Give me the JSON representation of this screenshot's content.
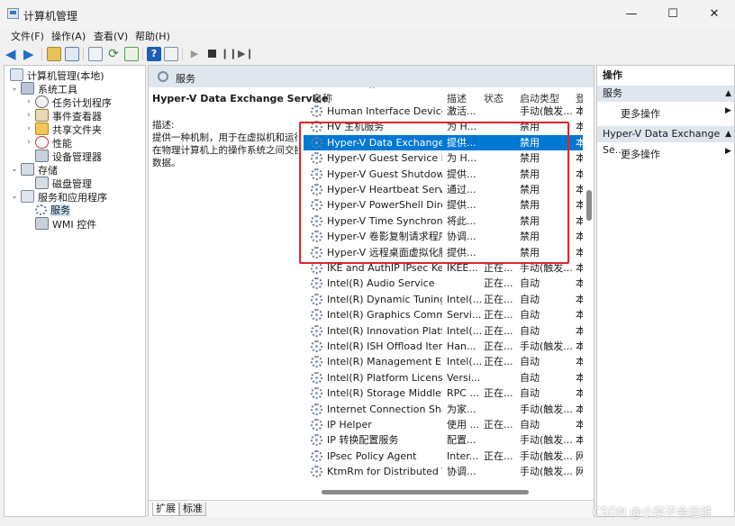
{
  "window": {
    "title": "计算机管理",
    "min": "—",
    "max": "☐",
    "close": "✕"
  },
  "menu": [
    "文件(F)",
    "操作(A)",
    "查看(V)",
    "帮助(H)"
  ],
  "tree": [
    {
      "label": "计算机管理(本地)",
      "expander": ""
    },
    {
      "label": "系统工具",
      "expander": "⌄"
    },
    {
      "label": "任务计划程序",
      "expander": "›"
    },
    {
      "label": "事件查看器",
      "expander": "›"
    },
    {
      "label": "共享文件夹",
      "expander": "›"
    },
    {
      "label": "性能",
      "expander": "›"
    },
    {
      "label": "设备管理器",
      "expander": ""
    },
    {
      "label": "存储",
      "expander": "⌄"
    },
    {
      "label": "磁盘管理",
      "expander": ""
    },
    {
      "label": "服务和应用程序",
      "expander": "⌄"
    },
    {
      "label": "服务",
      "expander": ""
    },
    {
      "label": "WMI 控件",
      "expander": ""
    }
  ],
  "center": {
    "header": "服务",
    "detail_title": "Hyper-V Data Exchange Service",
    "desc_label": "描述:",
    "desc_lines": [
      "提供一种机制，用于在虚拟机和运行",
      "在物理计算机上的操作系统之间交换",
      "数据。"
    ]
  },
  "columns": {
    "name": "名称",
    "desc": "描述",
    "status": "状态",
    "startup": "启动类型",
    "logon": "登"
  },
  "services": [
    {
      "name": "Human Interface Device S...",
      "desc": "激活...",
      "status": "",
      "startup": "手动(触发...",
      "logon": "本"
    },
    {
      "name": "HV 主机服务",
      "desc": "为 H...",
      "status": "",
      "startup": "禁用",
      "logon": "本"
    },
    {
      "name": "Hyper-V Data Exchange Se...",
      "desc": "提供...",
      "status": "",
      "startup": "禁用",
      "logon": "本"
    },
    {
      "name": "Hyper-V Guest Service Int...",
      "desc": "为 H...",
      "status": "",
      "startup": "禁用",
      "logon": "本"
    },
    {
      "name": "Hyper-V Guest Shutdown ...",
      "desc": "提供...",
      "status": "",
      "startup": "禁用",
      "logon": "本"
    },
    {
      "name": "Hyper-V Heartbeat Service",
      "desc": "通过...",
      "status": "",
      "startup": "禁用",
      "logon": "本"
    },
    {
      "name": "Hyper-V PowerShell Direct...",
      "desc": "提供...",
      "status": "",
      "startup": "禁用",
      "logon": "本"
    },
    {
      "name": "Hyper-V Time Synchroniza...",
      "desc": "将此...",
      "status": "",
      "startup": "禁用",
      "logon": "本"
    },
    {
      "name": "Hyper-V 卷影复制请求程序",
      "desc": "协调...",
      "status": "",
      "startup": "禁用",
      "logon": "本"
    },
    {
      "name": "Hyper-V 远程桌面虚拟化服...",
      "desc": "提供...",
      "status": "",
      "startup": "禁用",
      "logon": "本"
    },
    {
      "name": "IKE and AuthIP IPsec Keyin...",
      "desc": "IKEE...",
      "status": "正在...",
      "startup": "手动(触发...",
      "logon": "本"
    },
    {
      "name": "Intel(R) Audio Service",
      "desc": "",
      "status": "正在...",
      "startup": "自动",
      "logon": "本"
    },
    {
      "name": "Intel(R) Dynamic Tuning T...",
      "desc": "Intel(...",
      "status": "正在...",
      "startup": "自动",
      "logon": "本"
    },
    {
      "name": "Intel(R) Graphics Comman...",
      "desc": "Servi...",
      "status": "正在...",
      "startup": "自动",
      "logon": "本"
    },
    {
      "name": "Intel(R) Innovation Platfor...",
      "desc": "Intel(...",
      "status": "正在...",
      "startup": "自动",
      "logon": "本"
    },
    {
      "name": "Intel(R) ISH Offload Item S...",
      "desc": "Han...",
      "status": "正在...",
      "startup": "手动(触发...",
      "logon": "本"
    },
    {
      "name": "Intel(R) Management Engi...",
      "desc": "Intel(...",
      "status": "正在...",
      "startup": "自动",
      "logon": "本"
    },
    {
      "name": "Intel(R) Platform License M...",
      "desc": "Versi...",
      "status": "",
      "startup": "自动",
      "logon": "本"
    },
    {
      "name": "Intel(R) Storage Middlewar...",
      "desc": "RPC ...",
      "status": "正在...",
      "startup": "自动",
      "logon": "本"
    },
    {
      "name": "Internet Connection Sharin...",
      "desc": "为家...",
      "status": "",
      "startup": "手动(触发...",
      "logon": "本"
    },
    {
      "name": "IP Helper",
      "desc": "使用 ...",
      "status": "正在...",
      "startup": "自动",
      "logon": "本"
    },
    {
      "name": "IP 转换配置服务",
      "desc": "配置...",
      "status": "",
      "startup": "手动(触发...",
      "logon": "本"
    },
    {
      "name": "IPsec Policy Agent",
      "desc": "Inter...",
      "status": "正在...",
      "startup": "手动(触发...",
      "logon": "网"
    },
    {
      "name": "KtmRm for Distributed Tra...",
      "desc": "协调...",
      "status": "",
      "startup": "手动(触发...",
      "logon": "网"
    }
  ],
  "tabs": [
    "扩展",
    "标准"
  ],
  "actions": {
    "header": "操作",
    "group1": "服务",
    "more1": "更多操作",
    "group2": "Hyper-V Data Exchange Se...",
    "more2": "更多操作"
  },
  "watermark": "CSDN @小李不会运维"
}
